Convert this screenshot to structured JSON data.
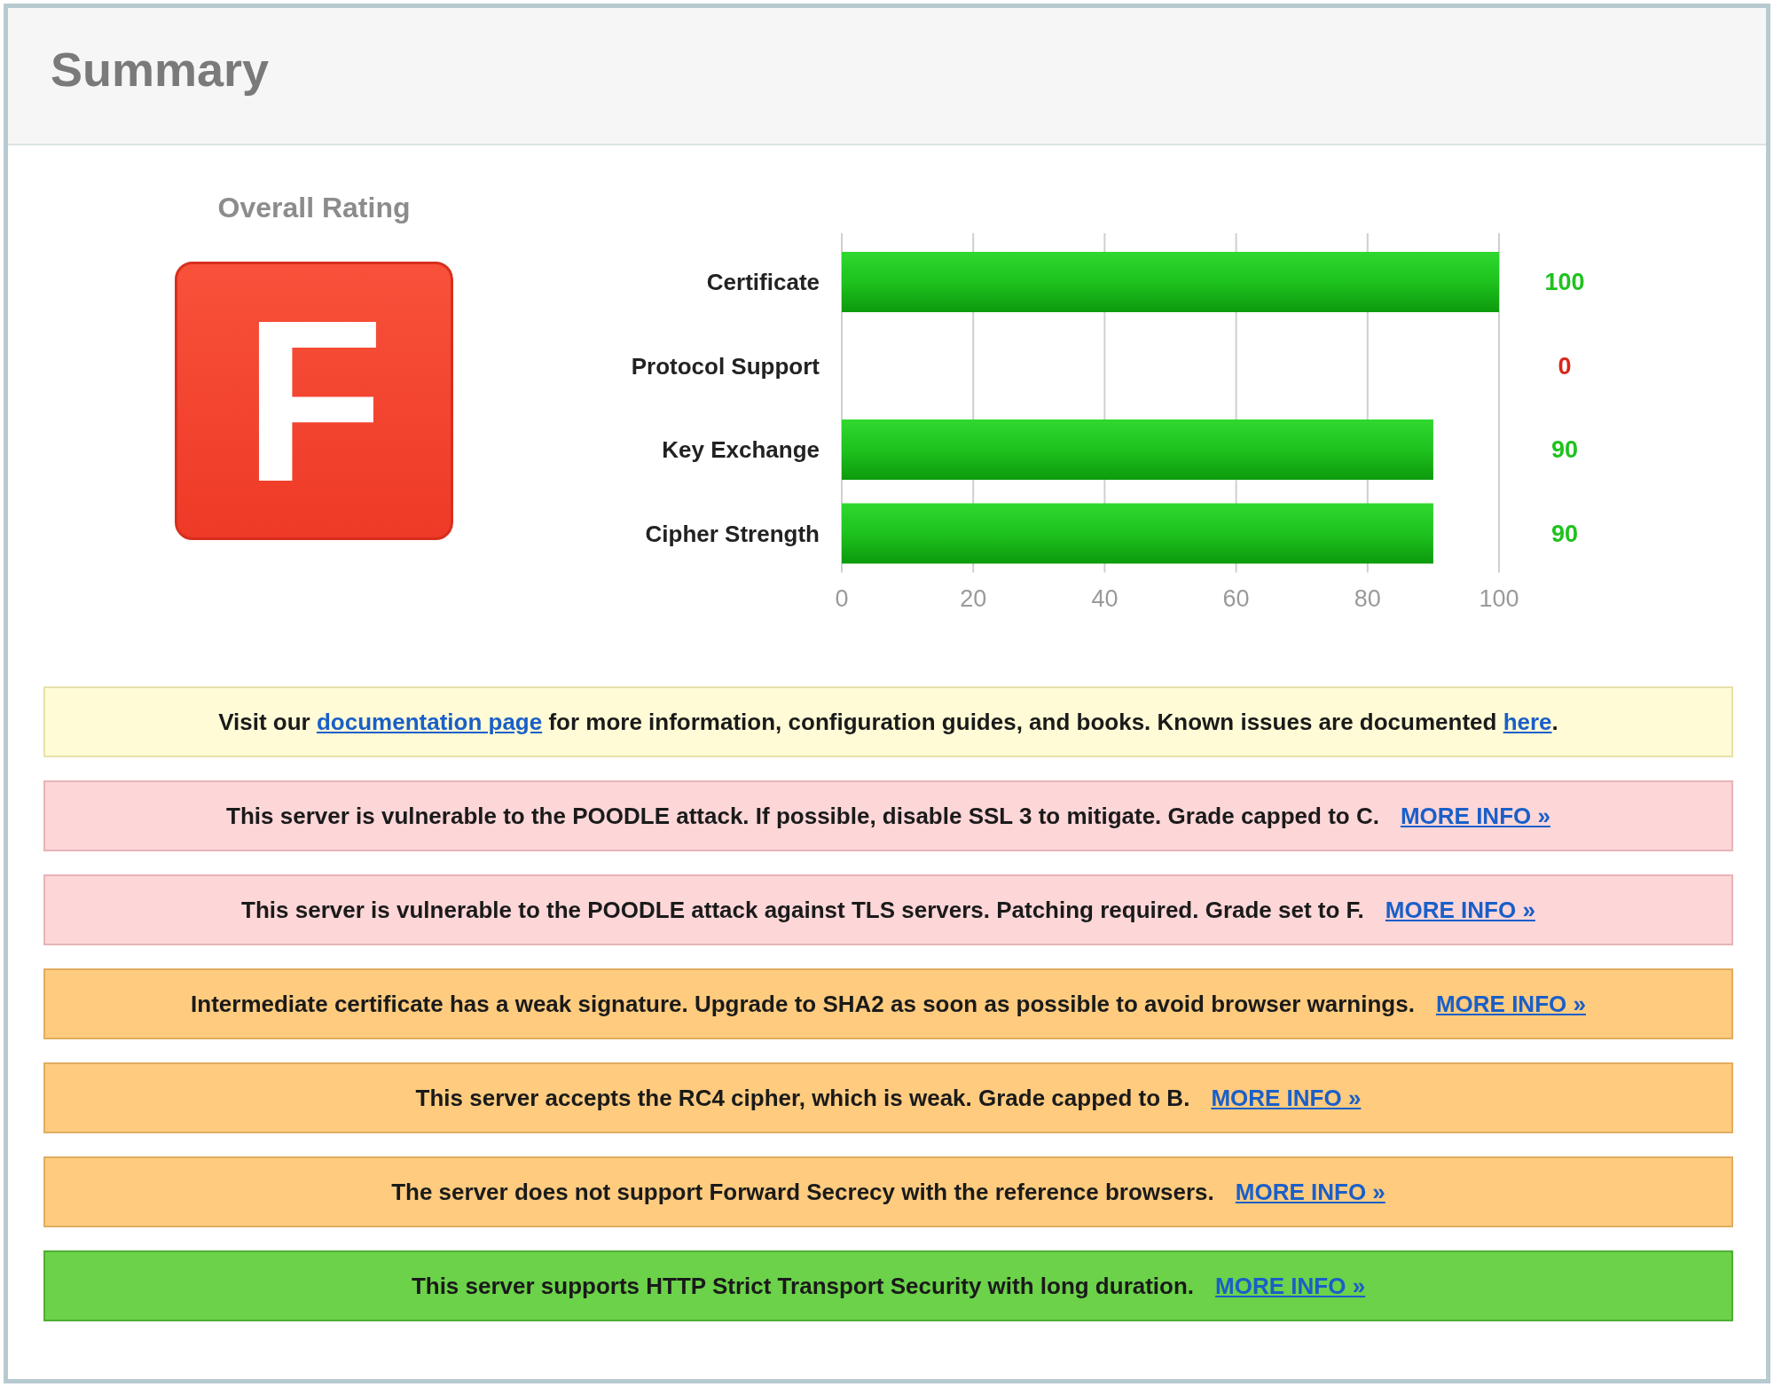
{
  "header": {
    "title": "Summary"
  },
  "rating": {
    "label": "Overall Rating",
    "grade": "F"
  },
  "scores": {
    "chart_data": {
      "type": "bar",
      "orientation": "horizontal",
      "categories": [
        "Certificate",
        "Protocol Support",
        "Key Exchange",
        "Cipher Strength"
      ],
      "values": [
        100,
        0,
        90,
        90
      ],
      "grid": true,
      "xlim": [
        0,
        100
      ],
      "xticks": [
        0,
        20,
        40,
        60,
        80,
        100
      ],
      "value_labels": [
        "100",
        "0",
        "90",
        "90"
      ]
    }
  },
  "notices": [
    {
      "kind": "info",
      "parts": [
        {
          "text": "Visit our "
        },
        {
          "link": "documentation page"
        },
        {
          "text": " for more information, configuration guides, and books. Known issues are documented "
        },
        {
          "link": "here"
        },
        {
          "text": "."
        }
      ]
    },
    {
      "kind": "error",
      "text": "This server is vulnerable to the POODLE attack. If possible, disable SSL 3 to mitigate. Grade capped to C.",
      "link": "MORE INFO »"
    },
    {
      "kind": "error",
      "text": "This server is vulnerable to the POODLE attack against TLS servers. Patching required. Grade set to F.",
      "link": "MORE INFO »"
    },
    {
      "kind": "warning",
      "text": "Intermediate certificate has a weak signature. Upgrade to SHA2 as soon as possible to avoid browser warnings.",
      "link": "MORE INFO »"
    },
    {
      "kind": "warning",
      "text": "This server accepts the RC4 cipher, which is weak. Grade capped to B.",
      "link": "MORE INFO »"
    },
    {
      "kind": "warning",
      "text": "The server does not support Forward Secrecy with the reference browsers.",
      "link": "MORE INFO »"
    },
    {
      "kind": "good",
      "text": "This server supports HTTP Strict Transport Security with long duration.",
      "link": "MORE INFO »"
    }
  ]
}
